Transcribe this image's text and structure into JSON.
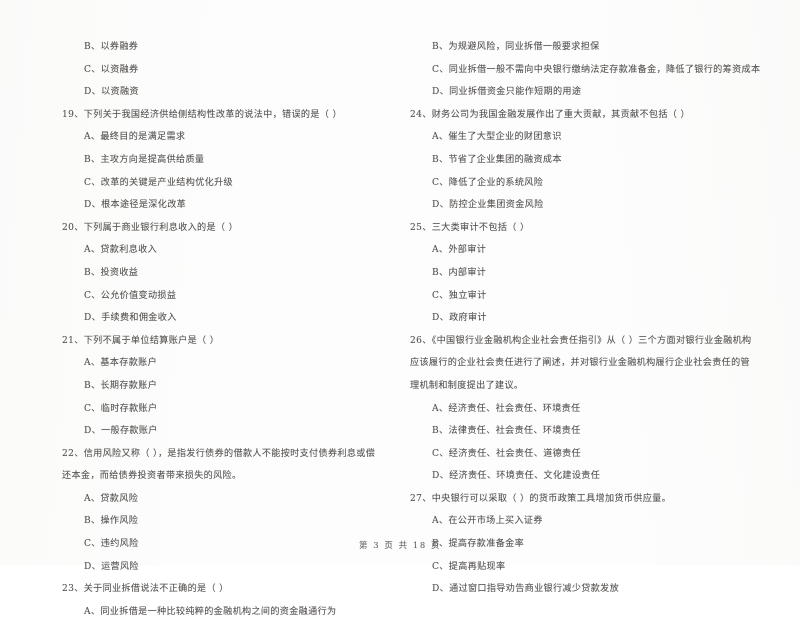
{
  "document": {
    "type": "scanned-exam-paper",
    "language": "zh-CN",
    "footer": "第 3 页 共 18 页"
  },
  "left_column": {
    "continued_options": [
      "B、以券融券",
      "C、以资融券",
      "D、以资融资"
    ],
    "questions": [
      {
        "number": "19",
        "stem": "19、下列关于我国经济供给侧结构性改革的说法中，错误的是（     ）",
        "options": [
          "A、最终目的是满足需求",
          "B、主攻方向是提高供给质量",
          "C、改革的关键是产业结构优化升级",
          "D、根本途径是深化改革"
        ]
      },
      {
        "number": "20",
        "stem": "20、下列属于商业银行利息收入的是（     ）",
        "options": [
          "A、贷款利息收入",
          "B、投资收益",
          "C、公允价值变动损益",
          "D、手续费和佣金收入"
        ]
      },
      {
        "number": "21",
        "stem": "21、下列不属于单位结算账户是（     ）",
        "options": [
          "A、基本存款账户",
          "B、长期存款账户",
          "C、临时存款账户",
          "D、一般存款账户"
        ]
      },
      {
        "number": "22",
        "stem": "22、信用风险又称（     ），是指发行债券的借款人不能按时支付债券利息或偿还本金，而给债券投资者带来损失的风险。",
        "options": [
          "A、贷款风险",
          "B、操作风险",
          "C、违约风险",
          "D、运营风险"
        ]
      },
      {
        "number": "23",
        "stem": "23、关于同业拆借说法不正确的是（     ）",
        "options": [
          "A、同业拆借是一种比较纯粹的金融机构之间的资金融通行为"
        ]
      }
    ]
  },
  "right_column": {
    "continued_options": [
      "B、为规避风险，同业拆借一般要求担保",
      "C、同业拆借一般不需向中央银行缴纳法定存款准备金，降低了银行的筹资成本",
      "D、同业拆借资金只能作短期的用途"
    ],
    "questions": [
      {
        "number": "24",
        "stem": "24、财务公司为我国金融发展作出了重大贡献，其贡献不包括（     ）",
        "options": [
          "A、催生了大型企业的财团意识",
          "B、节省了企业集团的融资成本",
          "C、降低了企业的系统风险",
          "D、防控企业集团资金风险"
        ]
      },
      {
        "number": "25",
        "stem": "25、三大类审计不包括（     ）",
        "options": [
          "A、外部审计",
          "B、内部审计",
          "C、独立审计",
          "D、政府审计"
        ]
      },
      {
        "number": "26",
        "stem": "26、《中国银行业金融机构企业社会责任指引》从（     ）三个方面对银行业金融机构应该履行的企业社会责任进行了阐述，并对银行业金融机构履行企业社会责任的管理机制和制度提出了建议。",
        "options": [
          "A、经济责任、社会责任、环境责任",
          "B、法律责任、社会责任、环境责任",
          "C、经济责任、社会责任、道德责任",
          "D、经济责任、环境责任、文化建设责任"
        ]
      },
      {
        "number": "27",
        "stem": "27、中央银行可以采取（     ）的货币政策工具增加货币供应量。",
        "options": [
          "A、在公开市场上买入证券",
          "B、提高存款准备金率",
          "C、提高再贴现率",
          "D、通过窗口指导劝告商业银行减少贷款发放"
        ]
      }
    ]
  }
}
